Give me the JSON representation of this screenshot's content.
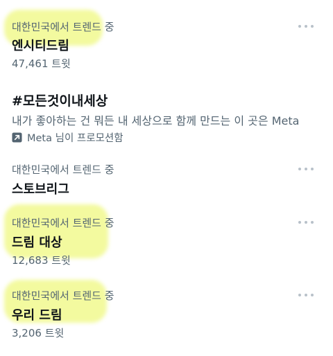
{
  "trends": [
    {
      "context": "대한민국에서 트렌드 중",
      "title": "엔시티드림",
      "count": "47,461 트윗"
    },
    {
      "title": "#모든것이내세상",
      "description": "내가 좋아하는 건 뭐든 내 세상으로 함께 만드는 이 곳은 Meta",
      "promoted": "Meta 님이 프로모션함"
    },
    {
      "context": "대한민국에서 트렌드 중",
      "title": "스토브리그"
    },
    {
      "context": "대한민국에서 트렌드 중",
      "title": "드림 대상",
      "count": "12,683 트윗"
    },
    {
      "context": "대한민국에서 트렌드 중",
      "title": "우리 드림",
      "count": "3,206 트윗"
    }
  ],
  "icons": {
    "more": "more-horizontal-icon",
    "promoted": "promoted-arrow-icon"
  },
  "colors": {
    "highlight": "#e9f550",
    "secondary_text": "#536471",
    "primary_text": "#0f1419"
  }
}
